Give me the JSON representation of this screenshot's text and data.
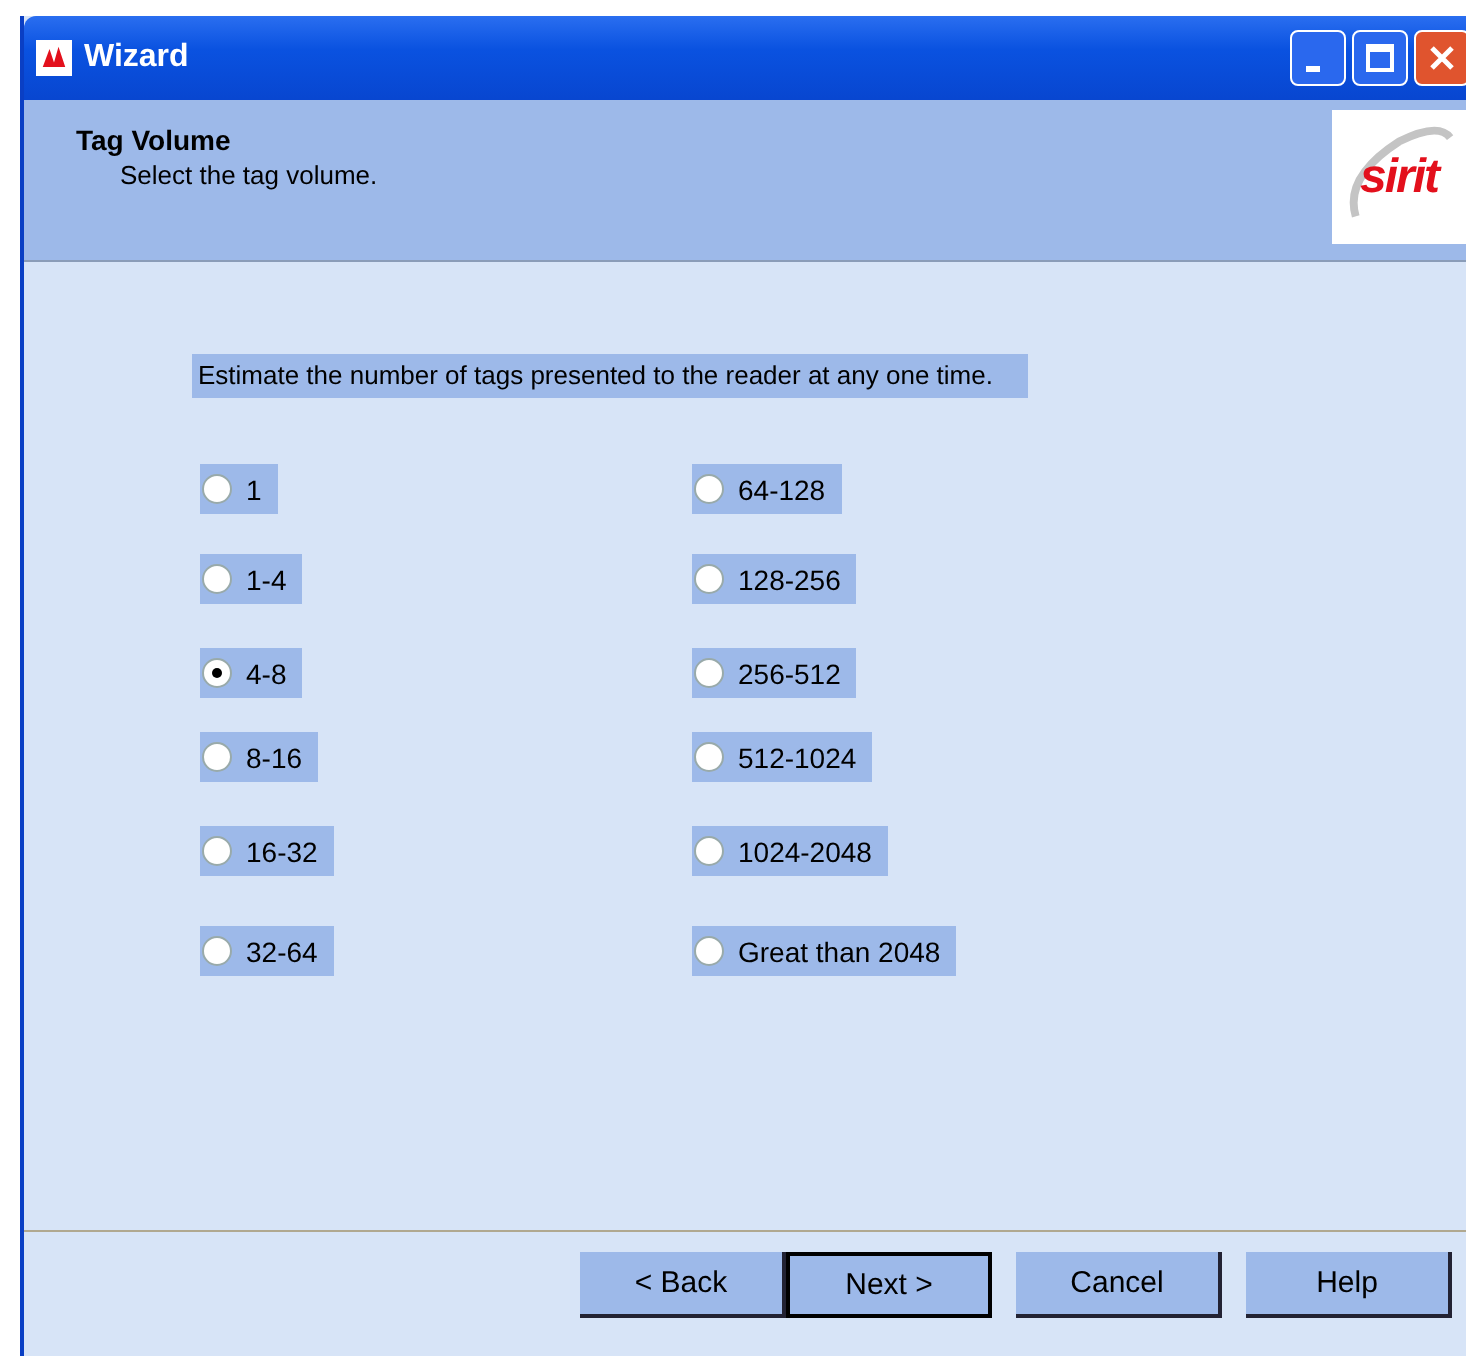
{
  "window": {
    "title": "Wizard"
  },
  "header": {
    "title": "Tag Volume",
    "subtitle": "Select the tag volume.",
    "logo_text": "sirit"
  },
  "question": "Estimate the number of tags presented to the reader at any one time.",
  "options": [
    {
      "label": "1",
      "selected": false
    },
    {
      "label": "1-4",
      "selected": false
    },
    {
      "label": "4-8",
      "selected": true
    },
    {
      "label": "8-16",
      "selected": false
    },
    {
      "label": "16-32",
      "selected": false
    },
    {
      "label": "32-64",
      "selected": false
    },
    {
      "label": "64-128",
      "selected": false
    },
    {
      "label": "128-256",
      "selected": false
    },
    {
      "label": "256-512",
      "selected": false
    },
    {
      "label": "512-1024",
      "selected": false
    },
    {
      "label": "1024-2048",
      "selected": false
    },
    {
      "label": "Great than 2048",
      "selected": false
    }
  ],
  "buttons": [
    {
      "label": "< Back",
      "default": false
    },
    {
      "label": "Next >",
      "default": true
    },
    {
      "label": "Cancel",
      "default": false
    },
    {
      "label": "Help",
      "default": false
    }
  ]
}
